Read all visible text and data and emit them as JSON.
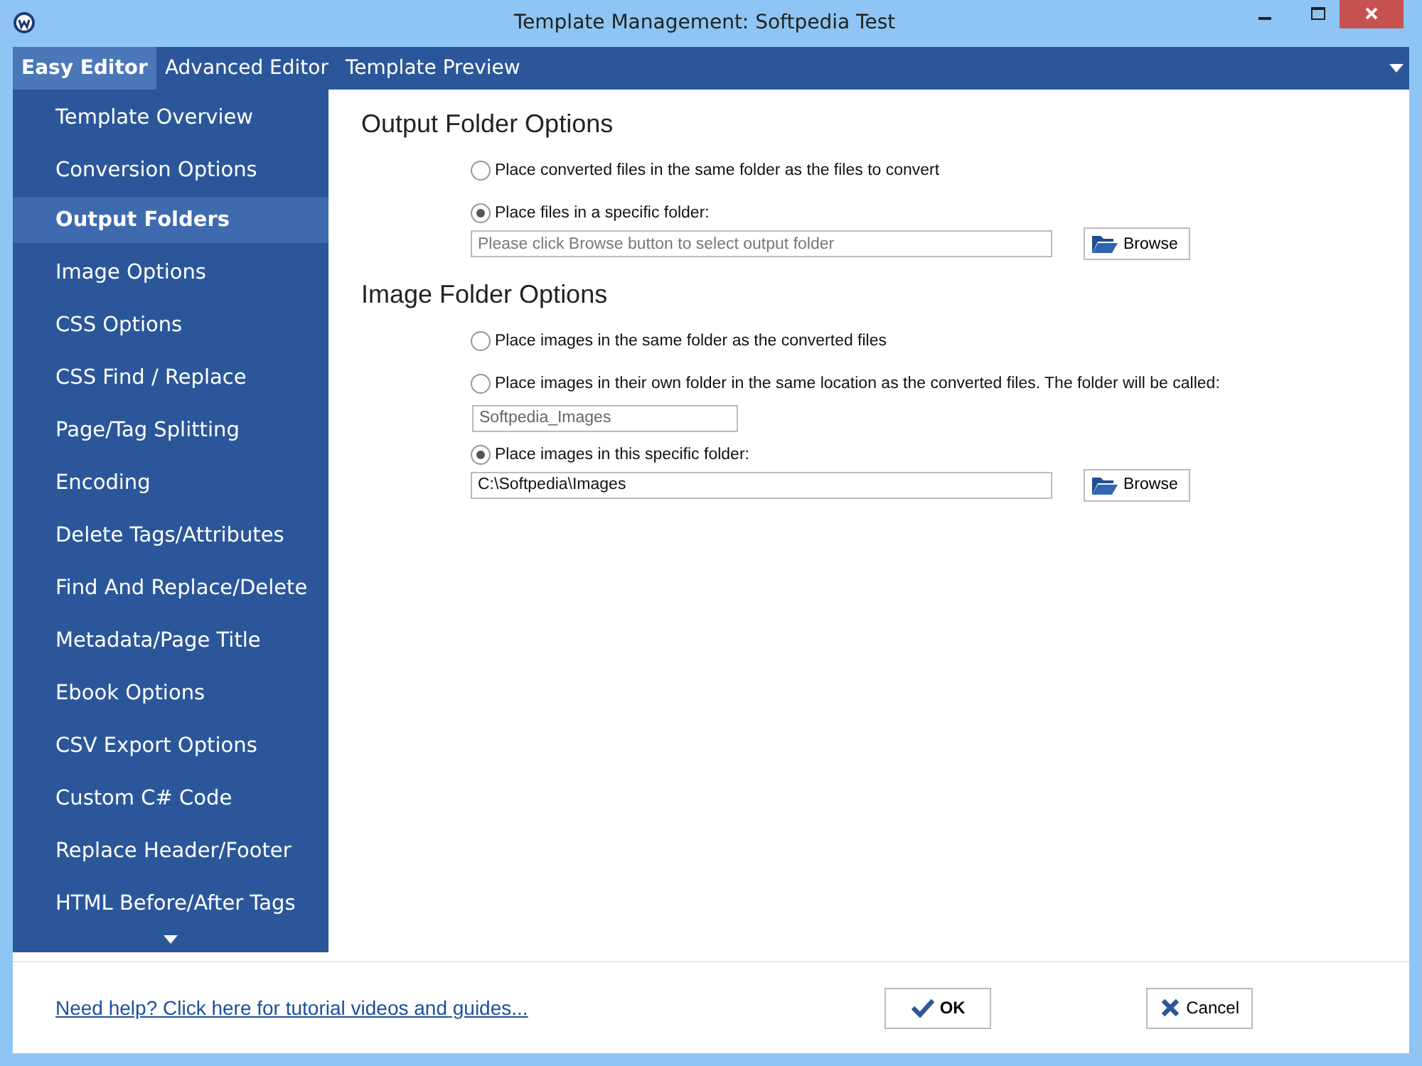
{
  "window": {
    "title": "Template Management: Softpedia Test"
  },
  "tabs": [
    {
      "label": "Easy Editor",
      "selected": true
    },
    {
      "label": "Advanced Editor",
      "selected": false
    },
    {
      "label": "Template Preview",
      "selected": false
    }
  ],
  "sidebar": {
    "items": [
      {
        "label": "Template Overview",
        "selected": false
      },
      {
        "label": "Conversion Options",
        "selected": false
      },
      {
        "label": "Output Folders",
        "selected": true
      },
      {
        "label": "Image Options",
        "selected": false
      },
      {
        "label": "CSS Options",
        "selected": false
      },
      {
        "label": "CSS Find / Replace",
        "selected": false
      },
      {
        "label": "Page/Tag Splitting",
        "selected": false
      },
      {
        "label": "Encoding",
        "selected": false
      },
      {
        "label": "Delete Tags/Attributes",
        "selected": false
      },
      {
        "label": "Find And Replace/Delete",
        "selected": false
      },
      {
        "label": "Metadata/Page Title",
        "selected": false
      },
      {
        "label": "Ebook Options",
        "selected": false
      },
      {
        "label": "CSV Export Options",
        "selected": false
      },
      {
        "label": "Custom C# Code",
        "selected": false
      },
      {
        "label": "Replace Header/Footer",
        "selected": false
      },
      {
        "label": "HTML Before/After Tags",
        "selected": false
      }
    ]
  },
  "sections": [
    {
      "title": "Output Folder Options",
      "rows": [
        {
          "kind": "radio",
          "label": "Place converted files in the same folder as the files to convert",
          "selected": false
        },
        {
          "kind": "radio",
          "label": "Place files in a specific folder:",
          "selected": true
        },
        {
          "kind": "path",
          "placeholder": "Please click Browse button to select output folder",
          "button": "Browse"
        }
      ]
    },
    {
      "title": "Image Folder Options",
      "rows": [
        {
          "kind": "radio",
          "label": "Place images in the same folder as the converted files",
          "selected": false
        },
        {
          "kind": "radio",
          "label": "Place images in their own folder in the same location as the converted files. The folder will be called:",
          "selected": false
        },
        {
          "kind": "name",
          "value": "Softpedia_Images"
        },
        {
          "kind": "radio",
          "label": "Place images in this specific folder:",
          "selected": true
        },
        {
          "kind": "path",
          "value": "C:\\Softpedia\\Images",
          "button": "Browse"
        }
      ]
    }
  ],
  "footer": {
    "help_link": "Need help? Click here for tutorial videos and guides...",
    "ok": "OK",
    "cancel": "Cancel"
  }
}
